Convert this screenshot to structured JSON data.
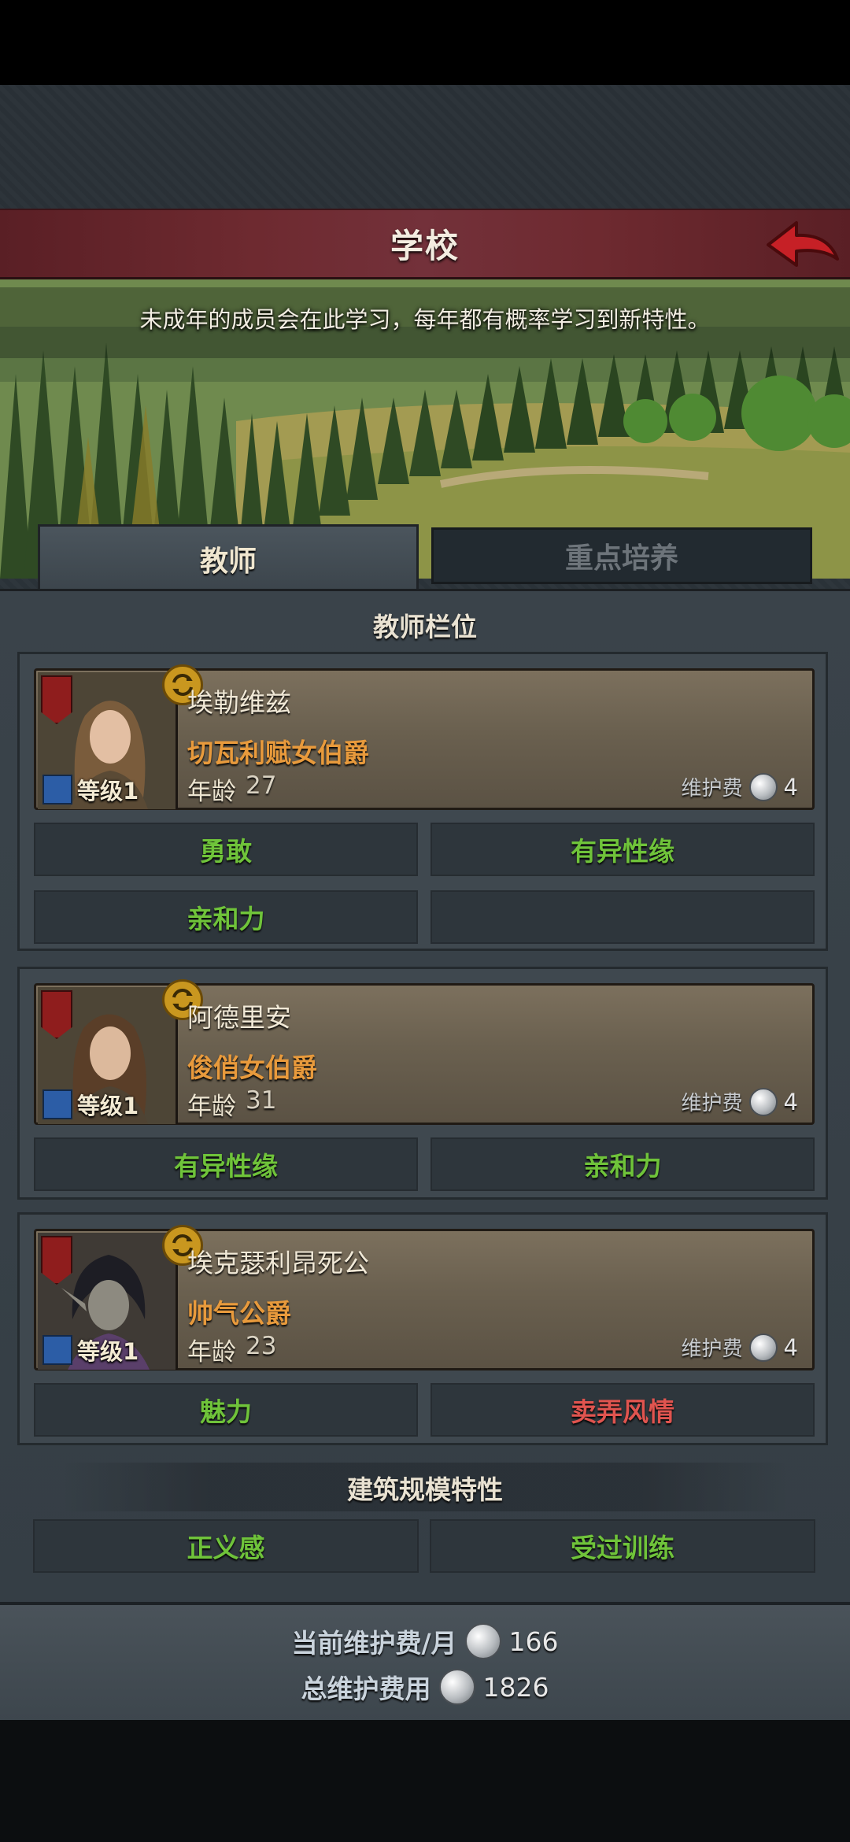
{
  "header": {
    "title": "学校"
  },
  "banner": {
    "description": "未成年的成员会在此学习，每年都有概率学习到新特性。"
  },
  "tabs": [
    {
      "label": "教师",
      "active": true
    },
    {
      "label": "重点培养",
      "active": false
    }
  ],
  "teachers_section": {
    "title": "教师栏位"
  },
  "teachers": [
    {
      "name": "埃勒维兹",
      "rank": "切瓦利赋女伯爵",
      "level": "等级1",
      "age_label": "年龄",
      "age": "27",
      "fee_label": "维护费",
      "fee": "4",
      "traits": [
        {
          "label": "勇敢",
          "color": "green"
        },
        {
          "label": "有异性缘",
          "color": "green"
        },
        {
          "label": "亲和力",
          "color": "green"
        },
        {
          "label": "",
          "color": "green"
        }
      ]
    },
    {
      "name": "阿德里安",
      "rank": "俊俏女伯爵",
      "level": "等级1",
      "age_label": "年龄",
      "age": "31",
      "fee_label": "维护费",
      "fee": "4",
      "traits": [
        {
          "label": "有异性缘",
          "color": "green"
        },
        {
          "label": "亲和力",
          "color": "green"
        }
      ]
    },
    {
      "name": "埃克瑟利昂死公",
      "rank": "帅气公爵",
      "level": "等级1",
      "age_label": "年龄",
      "age": "23",
      "fee_label": "维护费",
      "fee": "4",
      "traits": [
        {
          "label": "魅力",
          "color": "green"
        },
        {
          "label": "卖弄风情",
          "color": "red"
        }
      ]
    }
  ],
  "building_section": {
    "title": "建筑规模特性",
    "traits": [
      "正义感",
      "受过训练"
    ]
  },
  "footer": {
    "monthly_label": "当前维护费/月",
    "monthly_value": "166",
    "total_label": "总维护费用",
    "total_value": "1826"
  },
  "colors": {
    "trait_green": "#6fc33a",
    "trait_red": "#e0544f",
    "rank_orange": "#e89a3c",
    "title_bar": "#6e2a30"
  }
}
